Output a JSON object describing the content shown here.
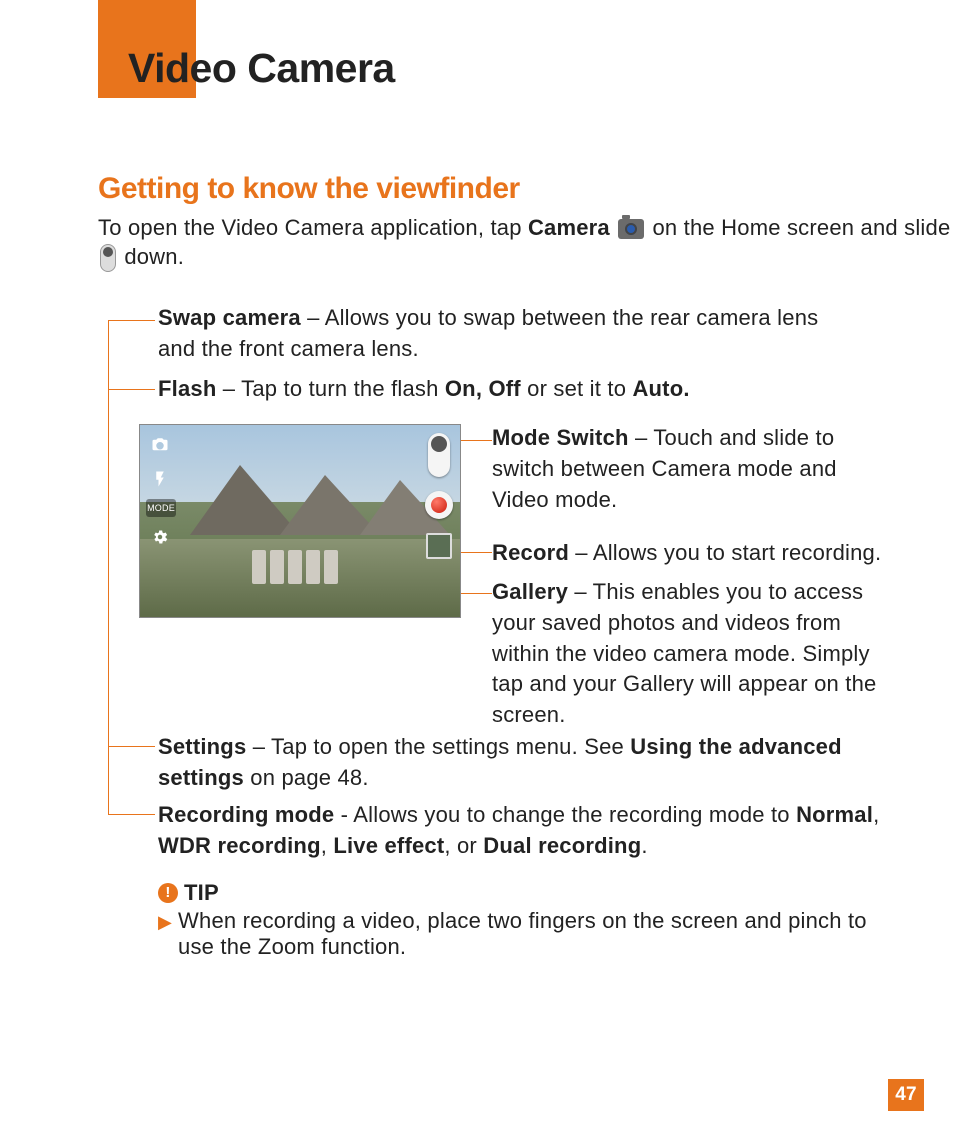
{
  "title": "Video Camera",
  "section_title": "Getting to know the viewfinder",
  "intro": {
    "pre": "To open the Video Camera application, tap ",
    "camera_label": "Camera",
    "mid": " on the Home screen and slide ",
    "post": " down."
  },
  "items": {
    "swap": {
      "label": "Swap camera",
      "text": " – Allows you to swap between the rear camera lens and the front camera lens."
    },
    "flash": {
      "label": "Flash",
      "t1": " – Tap to turn the flash ",
      "b1": "On, Off",
      "t2": " or set it to ",
      "b2": "Auto."
    },
    "modeswitch": {
      "label": "Mode Switch",
      "text": " – Touch and slide to switch between Camera mode and Video mode."
    },
    "record": {
      "label": "Record",
      "text": " – Allows you to start recording."
    },
    "gallery": {
      "label": "Gallery",
      "text": " – This enables you to access your saved photos and videos from within the video camera mode. Simply tap and your Gallery will appear on the screen."
    },
    "settings": {
      "label": "Settings",
      "t1": " – Tap to open the settings menu. See ",
      "b1": "Using the advanced settings",
      "t2": " on page 48."
    },
    "recmode": {
      "label": "Recording mode",
      "t1": " - Allows you to change the recording mode to ",
      "b1": "Normal",
      "t2": ", ",
      "b2": "WDR recording",
      "t3": ", ",
      "b3": "Live effect",
      "t4": ", or ",
      "b4": "Dual recording",
      "t5": "."
    }
  },
  "mode_label": "MODE",
  "tip": {
    "head": "TIP",
    "text": "When recording a video, place two fingers on the screen and pinch to use the Zoom function."
  },
  "page_number": "47"
}
